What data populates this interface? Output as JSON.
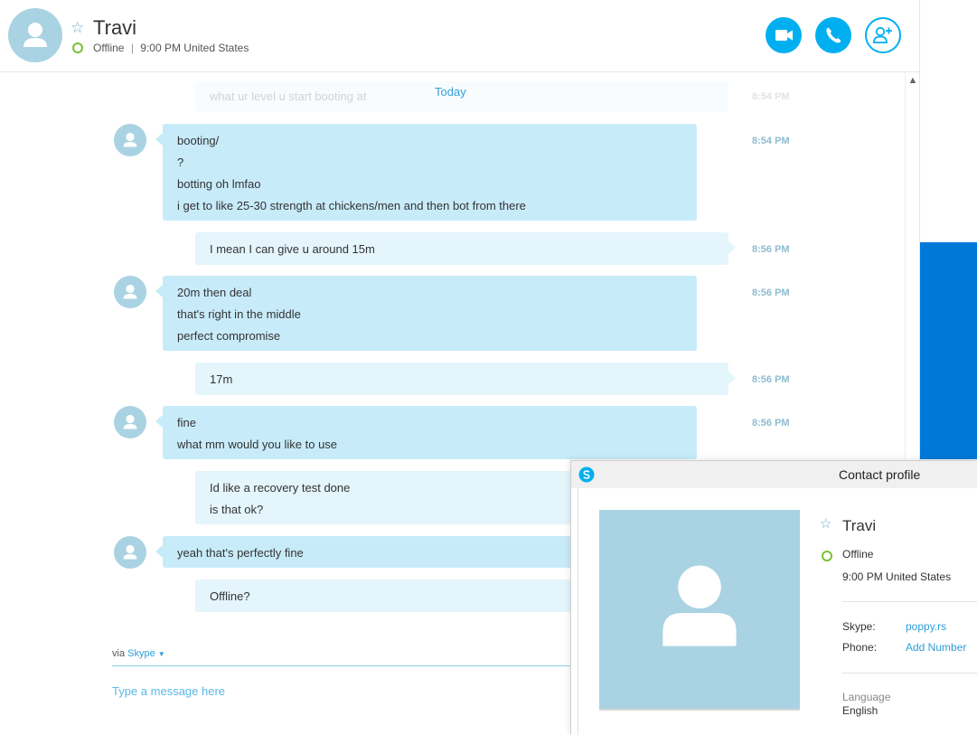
{
  "header": {
    "contact_name": "Travi",
    "status": "Offline",
    "separator": "|",
    "local_time": "9:00 PM United States",
    "buttons": {
      "video_call": "video-camera-icon",
      "audio_call": "phone-icon",
      "add_people": "add-person-icon"
    }
  },
  "chat": {
    "faded_message": {
      "text": "what ur level u start booting at",
      "time": "8:54 PM"
    },
    "date_divider": "Today",
    "messages": [
      {
        "direction": "in",
        "lines": [
          "booting/",
          "?",
          "botting oh lmfao",
          "i get to like 25-30 strength at chickens/men and then bot from there"
        ],
        "time": "8:54 PM"
      },
      {
        "direction": "out",
        "lines": [
          "I mean I can give u around 15m"
        ],
        "time": "8:56 PM"
      },
      {
        "direction": "in",
        "lines": [
          "20m then deal",
          "that's right in the middle",
          "perfect compromise"
        ],
        "time": "8:56 PM"
      },
      {
        "direction": "out",
        "lines": [
          "17m"
        ],
        "time": "8:56 PM"
      },
      {
        "direction": "in",
        "lines": [
          "fine",
          "what mm would you like to use"
        ],
        "time": "8:56 PM"
      },
      {
        "direction": "out",
        "lines": [
          "Id like a recovery test done",
          "is that ok?"
        ],
        "time": ""
      },
      {
        "direction": "in",
        "lines": [
          "yeah that's perfectly fine"
        ],
        "time": ""
      },
      {
        "direction": "out",
        "lines": [
          "Offline?"
        ],
        "time": ""
      }
    ]
  },
  "composer": {
    "via_label": "via",
    "via_service": "Skype",
    "placeholder": "Type a message here"
  },
  "profile": {
    "title": "Contact profile",
    "name": "Travi",
    "status": "Offline",
    "local_time": "9:00 PM United States",
    "skype_label": "Skype:",
    "skype_value": "poppy.rs",
    "phone_label": "Phone:",
    "phone_value": "Add Number",
    "language_label": "Language",
    "language_value": "English"
  },
  "colors": {
    "accent": "#00aff0",
    "incoming_bubble": "#c8ebfa",
    "outgoing_bubble": "#e4f5fc",
    "avatar_bg": "#a9d3e3",
    "status_offline": "#7cbf36",
    "side_panel": "#0078d7"
  }
}
